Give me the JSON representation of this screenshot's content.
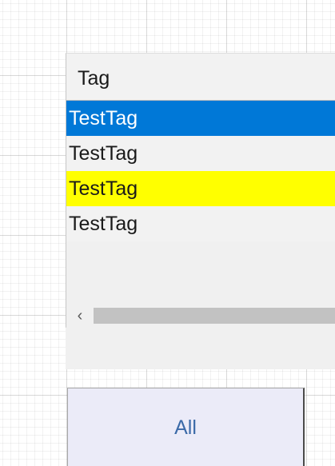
{
  "list": {
    "header": "Tag",
    "rows": [
      {
        "label": "TestTag",
        "state": "selected"
      },
      {
        "label": "TestTag",
        "state": "plain"
      },
      {
        "label": "TestTag",
        "state": "highlight"
      },
      {
        "label": "TestTag",
        "state": "plain"
      }
    ],
    "scroll_left_glyph": "‹"
  },
  "colors": {
    "selection": "#0078d7",
    "highlight": "#ffff00",
    "button_text": "#3b6aa8"
  },
  "button": {
    "label": "All"
  }
}
